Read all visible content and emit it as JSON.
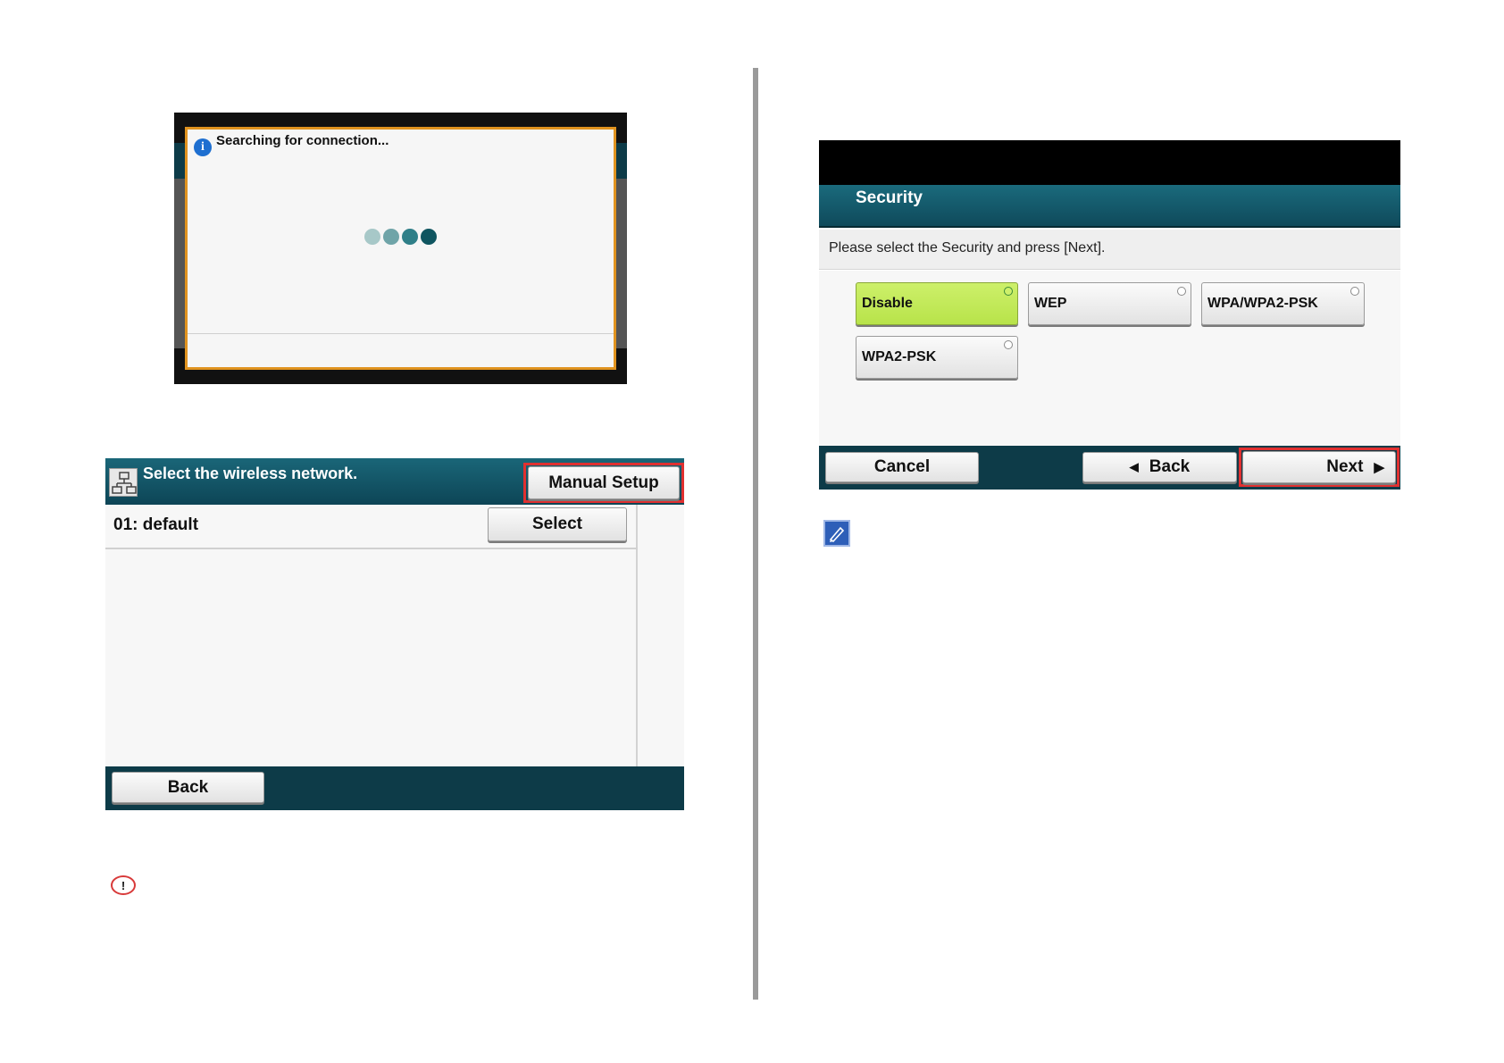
{
  "screen_search": {
    "message": "Searching for connection...",
    "info_icon": "info-icon",
    "progress_dot_colors": [
      "#a7c8c8",
      "#6fa4a8",
      "#2f7f88",
      "#0f5560"
    ]
  },
  "screen_wireless": {
    "title": "Select the wireless network.",
    "network_icon": "network-icon",
    "manual_setup_label": "Manual Setup",
    "rows": [
      {
        "label": "01: default",
        "button": "Select"
      }
    ],
    "back_label": "Back",
    "caution_icon": "caution-icon",
    "caution_symbol": "!"
  },
  "screen_security": {
    "title": "Security",
    "instruction": "Please select the Security and press [Next].",
    "options": [
      {
        "label": "Disable",
        "selected": true
      },
      {
        "label": "WEP",
        "selected": false
      },
      {
        "label": "WPA/WPA2-PSK",
        "selected": false
      },
      {
        "label": "WPA2-PSK",
        "selected": false
      }
    ],
    "cancel_label": "Cancel",
    "back_label": "Back",
    "next_label": "Next",
    "note_icon": "memo-icon"
  },
  "colors": {
    "highlight_red": "#e03030",
    "selected_green": "#c5ec5c",
    "header_teal": "#0d4556",
    "dialog_orange": "#e0931f"
  }
}
